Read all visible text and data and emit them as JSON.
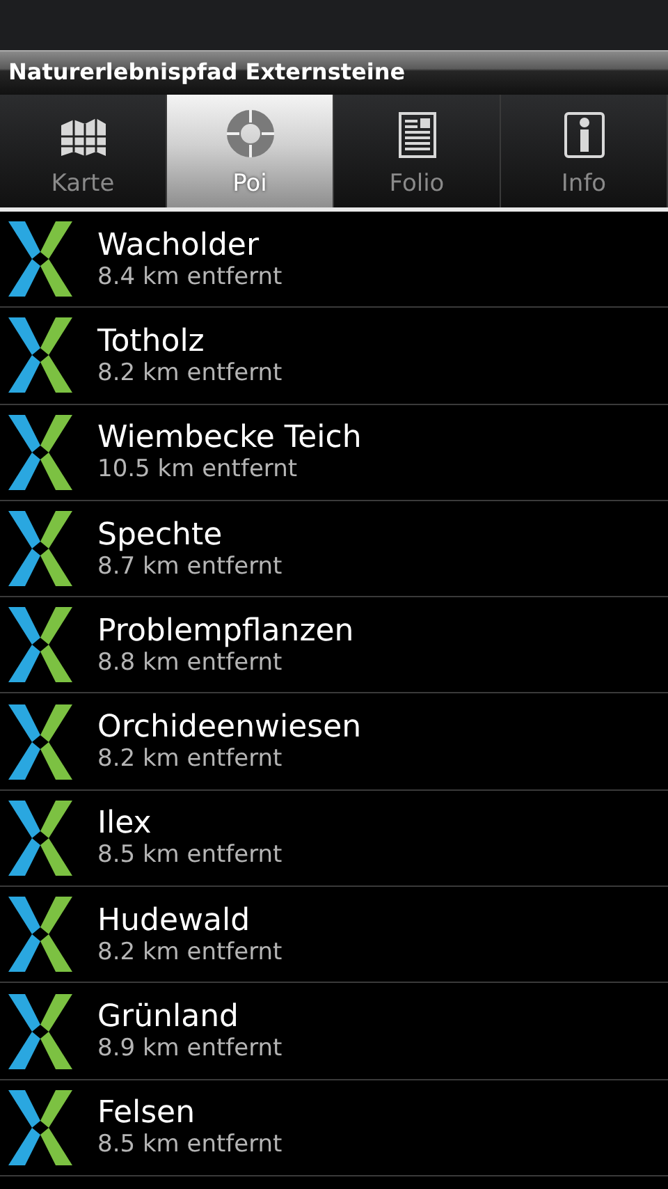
{
  "title": "Naturerlebnispfad Externsteine",
  "tabs": [
    {
      "label": "Karte",
      "selected": false
    },
    {
      "label": "Poi",
      "selected": true
    },
    {
      "label": "Folio",
      "selected": false
    },
    {
      "label": "Info",
      "selected": false
    }
  ],
  "items": [
    {
      "name": "Wacholder",
      "distance": "8.4 km entfernt"
    },
    {
      "name": "Totholz",
      "distance": "8.2 km entfernt"
    },
    {
      "name": "Wiembecke Teich",
      "distance": "10.5 km entfernt"
    },
    {
      "name": "Spechte",
      "distance": "8.7 km entfernt"
    },
    {
      "name": "Problempflanzen",
      "distance": "8.8 km entfernt"
    },
    {
      "name": "Orchideenwiesen",
      "distance": "8.2 km entfernt"
    },
    {
      "name": "Ilex",
      "distance": "8.5 km entfernt"
    },
    {
      "name": "Hudewald",
      "distance": "8.2 km entfernt"
    },
    {
      "name": "Grünland",
      "distance": "8.9 km entfernt"
    },
    {
      "name": "Felsen",
      "distance": "8.5 km entfernt"
    }
  ]
}
